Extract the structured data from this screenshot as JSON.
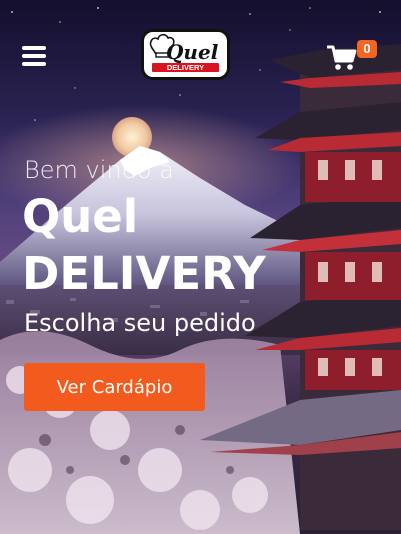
{
  "header": {
    "menu_icon": "hamburger-menu-icon",
    "logo_text_top": "Quel",
    "logo_text_bottom": "DELIVERY",
    "cart_icon": "shopping-cart-icon",
    "cart_count": "0"
  },
  "hero": {
    "welcome": "Bem vindo a",
    "brand_line1": "Quel",
    "brand_line2": "DELIVERY",
    "subtitle": "Escolha seu pedido",
    "cta_label": "Ver Cardápio"
  },
  "colors": {
    "accent": "#f35a1d",
    "badge": "#f26522",
    "logo_red": "#d7141f"
  }
}
